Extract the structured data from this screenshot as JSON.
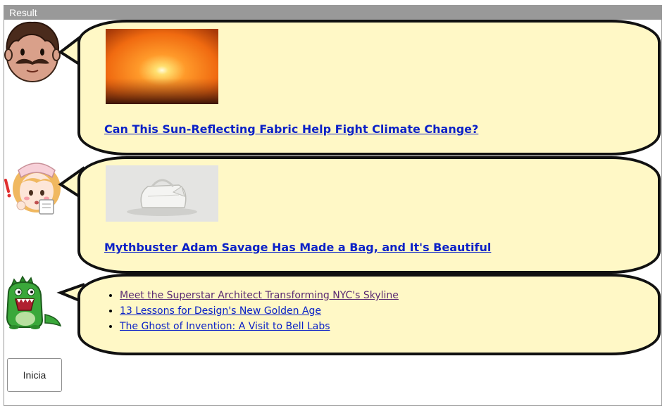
{
  "window": {
    "title": "Result"
  },
  "messages": [
    {
      "avatar_icon": "man-mustache-avatar-icon",
      "image_icon": "sunset-photo-icon",
      "link": "Can This Sun-Reflecting Fabric Help Fight Climate Change?"
    },
    {
      "avatar_icon": "nurse-girl-avatar-icon",
      "image_icon": "white-bag-photo-icon",
      "link": "Mythbuster Adam Savage Has Made a Bag, and It's Beautiful"
    },
    {
      "avatar_icon": "green-dinosaur-avatar-icon",
      "links": [
        {
          "text": "Meet the Superstar Architect Transforming NYC's Skyline",
          "visited": true
        },
        {
          "text": "13 Lessons for Design's New Golden Age",
          "visited": false
        },
        {
          "text": "The Ghost of Invention: A Visit to Bell Labs",
          "visited": false
        }
      ]
    }
  ],
  "buttons": {
    "start_label": "Inicia"
  },
  "colors": {
    "bubble_fill": "#fff8c6",
    "bubble_border": "#111111",
    "link": "#0b21c7",
    "visited_link": "#5a2a72",
    "titlebar": "#999999"
  }
}
